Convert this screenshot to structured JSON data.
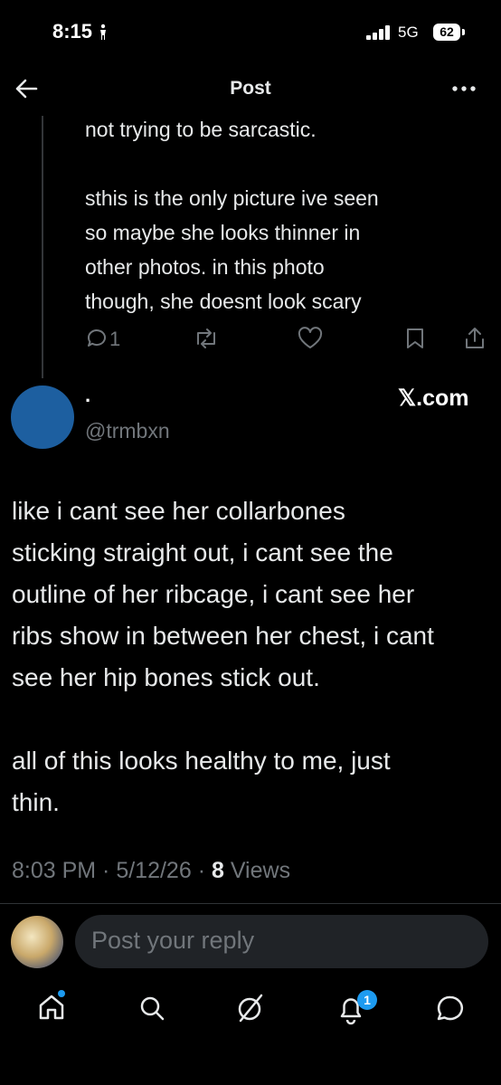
{
  "status_bar": {
    "time": "8:15",
    "network": "5G",
    "battery": "62"
  },
  "header": {
    "title": "Post"
  },
  "quoted_post": {
    "lines": [
      "not trying to be sarcastic.",
      "sthis is the only picture ive seen",
      "so maybe she looks thinner in",
      "other photos. in this photo",
      "though, she doesnt look scary"
    ],
    "reply_count": "1"
  },
  "author": {
    "name": "·",
    "handle": "@trmbxn",
    "source": "𝕏.com"
  },
  "post": {
    "lines": [
      "like i cant see her collarbones",
      "sticking straight out, i cant see the",
      "outline of her ribcage, i cant see her",
      "ribs show in between her chest, i cant",
      "see her hip bones stick out.",
      "all of this looks healthy to me, just",
      "thin."
    ],
    "time": "8:03 PM",
    "date": "5/12/26",
    "views_count": "8",
    "views_label": "Views"
  },
  "reply": {
    "placeholder": "Post your reply"
  },
  "nav": {
    "notifications_badge": "1"
  },
  "colors": {
    "accent": "#1d9bf0",
    "avatar": "#1d5fa0",
    "muted": "#71767b"
  }
}
